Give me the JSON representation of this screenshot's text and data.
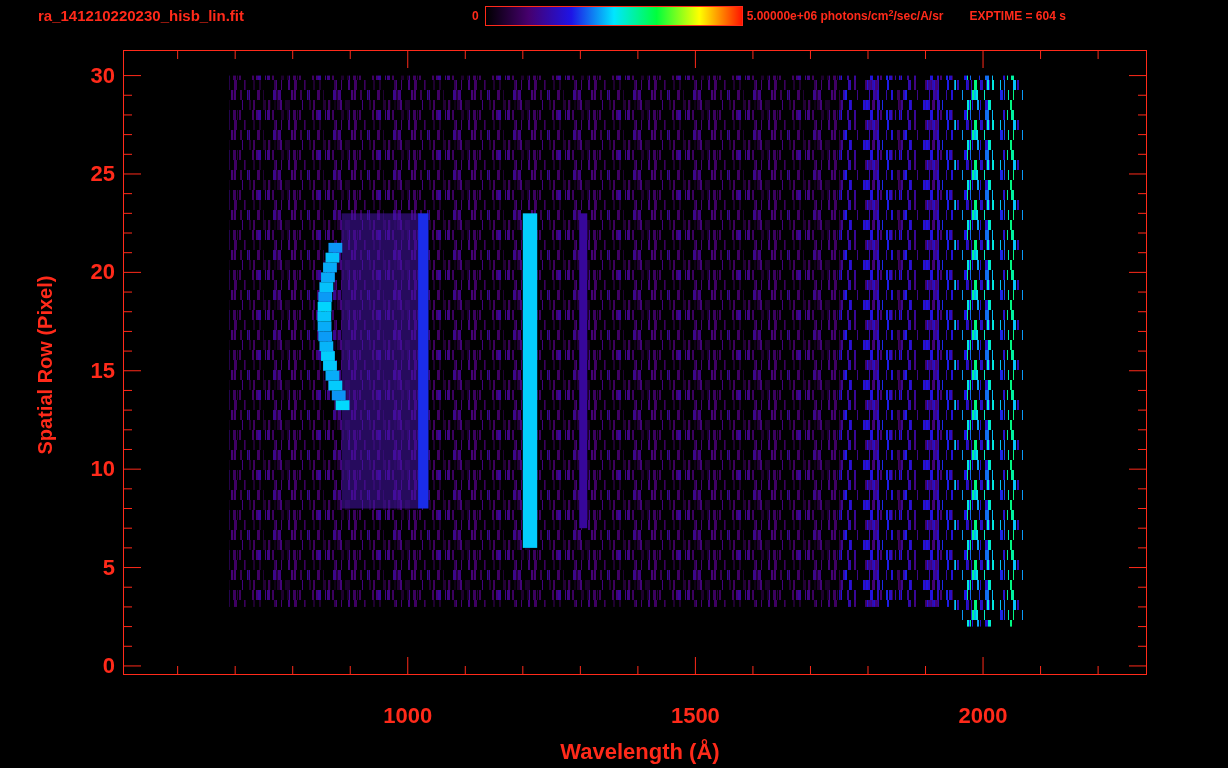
{
  "title": "ra_141210220230_hisb_lin.fit",
  "colorbar": {
    "min_label": "0",
    "max_label": "5.00000e+06 photons/cm$^{2}$/sec/A/sr"
  },
  "exposure": "EXPTIME = 604 s",
  "plot": {
    "xlabel": "Wavelength (Å)",
    "ylabel": "Spatial Row (Pixel)",
    "xticks": [
      "1000",
      "1500",
      "2000"
    ],
    "yticks": [
      "30",
      "25",
      "20",
      "15",
      "10",
      "5",
      "0"
    ]
  }
}
